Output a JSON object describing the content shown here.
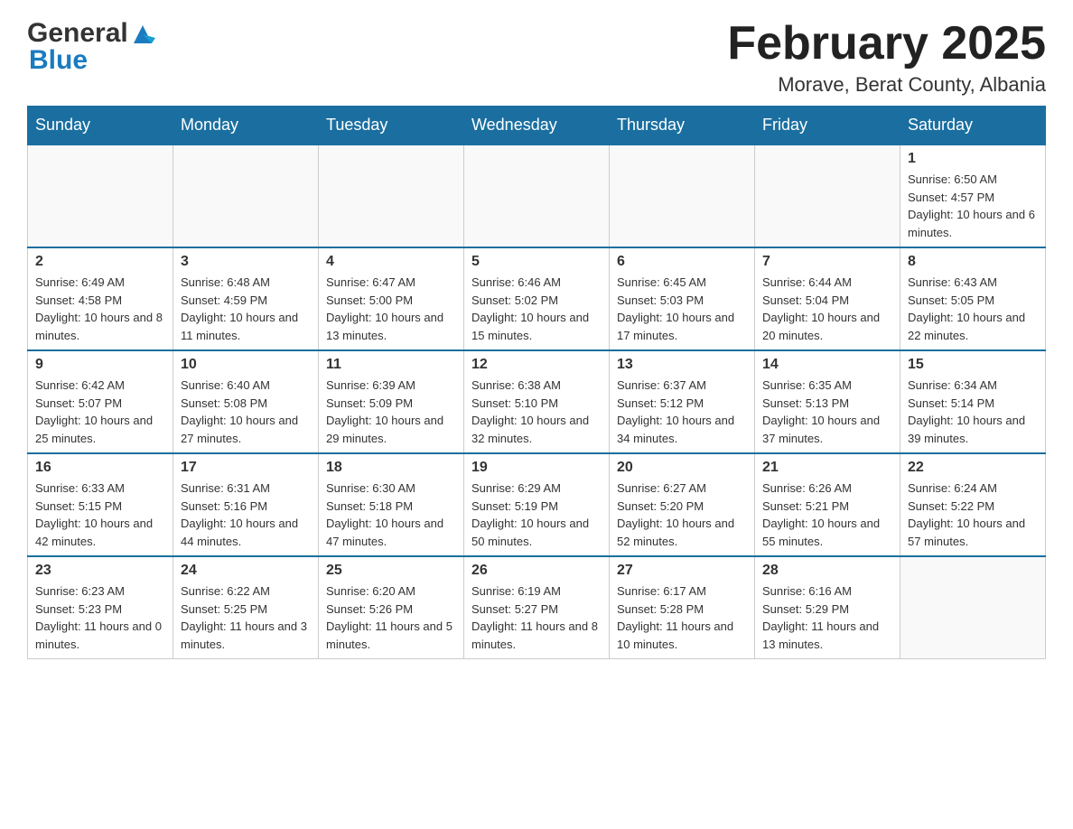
{
  "header": {
    "logo_general": "General",
    "logo_blue": "Blue",
    "title": "February 2025",
    "location": "Morave, Berat County, Albania"
  },
  "days_of_week": [
    "Sunday",
    "Monday",
    "Tuesday",
    "Wednesday",
    "Thursday",
    "Friday",
    "Saturday"
  ],
  "weeks": [
    {
      "cells": [
        {
          "day": null,
          "info": null
        },
        {
          "day": null,
          "info": null
        },
        {
          "day": null,
          "info": null
        },
        {
          "day": null,
          "info": null
        },
        {
          "day": null,
          "info": null
        },
        {
          "day": null,
          "info": null
        },
        {
          "day": "1",
          "info": "Sunrise: 6:50 AM\nSunset: 4:57 PM\nDaylight: 10 hours and 6 minutes."
        }
      ]
    },
    {
      "cells": [
        {
          "day": "2",
          "info": "Sunrise: 6:49 AM\nSunset: 4:58 PM\nDaylight: 10 hours and 8 minutes."
        },
        {
          "day": "3",
          "info": "Sunrise: 6:48 AM\nSunset: 4:59 PM\nDaylight: 10 hours and 11 minutes."
        },
        {
          "day": "4",
          "info": "Sunrise: 6:47 AM\nSunset: 5:00 PM\nDaylight: 10 hours and 13 minutes."
        },
        {
          "day": "5",
          "info": "Sunrise: 6:46 AM\nSunset: 5:02 PM\nDaylight: 10 hours and 15 minutes."
        },
        {
          "day": "6",
          "info": "Sunrise: 6:45 AM\nSunset: 5:03 PM\nDaylight: 10 hours and 17 minutes."
        },
        {
          "day": "7",
          "info": "Sunrise: 6:44 AM\nSunset: 5:04 PM\nDaylight: 10 hours and 20 minutes."
        },
        {
          "day": "8",
          "info": "Sunrise: 6:43 AM\nSunset: 5:05 PM\nDaylight: 10 hours and 22 minutes."
        }
      ]
    },
    {
      "cells": [
        {
          "day": "9",
          "info": "Sunrise: 6:42 AM\nSunset: 5:07 PM\nDaylight: 10 hours and 25 minutes."
        },
        {
          "day": "10",
          "info": "Sunrise: 6:40 AM\nSunset: 5:08 PM\nDaylight: 10 hours and 27 minutes."
        },
        {
          "day": "11",
          "info": "Sunrise: 6:39 AM\nSunset: 5:09 PM\nDaylight: 10 hours and 29 minutes."
        },
        {
          "day": "12",
          "info": "Sunrise: 6:38 AM\nSunset: 5:10 PM\nDaylight: 10 hours and 32 minutes."
        },
        {
          "day": "13",
          "info": "Sunrise: 6:37 AM\nSunset: 5:12 PM\nDaylight: 10 hours and 34 minutes."
        },
        {
          "day": "14",
          "info": "Sunrise: 6:35 AM\nSunset: 5:13 PM\nDaylight: 10 hours and 37 minutes."
        },
        {
          "day": "15",
          "info": "Sunrise: 6:34 AM\nSunset: 5:14 PM\nDaylight: 10 hours and 39 minutes."
        }
      ]
    },
    {
      "cells": [
        {
          "day": "16",
          "info": "Sunrise: 6:33 AM\nSunset: 5:15 PM\nDaylight: 10 hours and 42 minutes."
        },
        {
          "day": "17",
          "info": "Sunrise: 6:31 AM\nSunset: 5:16 PM\nDaylight: 10 hours and 44 minutes."
        },
        {
          "day": "18",
          "info": "Sunrise: 6:30 AM\nSunset: 5:18 PM\nDaylight: 10 hours and 47 minutes."
        },
        {
          "day": "19",
          "info": "Sunrise: 6:29 AM\nSunset: 5:19 PM\nDaylight: 10 hours and 50 minutes."
        },
        {
          "day": "20",
          "info": "Sunrise: 6:27 AM\nSunset: 5:20 PM\nDaylight: 10 hours and 52 minutes."
        },
        {
          "day": "21",
          "info": "Sunrise: 6:26 AM\nSunset: 5:21 PM\nDaylight: 10 hours and 55 minutes."
        },
        {
          "day": "22",
          "info": "Sunrise: 6:24 AM\nSunset: 5:22 PM\nDaylight: 10 hours and 57 minutes."
        }
      ]
    },
    {
      "cells": [
        {
          "day": "23",
          "info": "Sunrise: 6:23 AM\nSunset: 5:23 PM\nDaylight: 11 hours and 0 minutes."
        },
        {
          "day": "24",
          "info": "Sunrise: 6:22 AM\nSunset: 5:25 PM\nDaylight: 11 hours and 3 minutes."
        },
        {
          "day": "25",
          "info": "Sunrise: 6:20 AM\nSunset: 5:26 PM\nDaylight: 11 hours and 5 minutes."
        },
        {
          "day": "26",
          "info": "Sunrise: 6:19 AM\nSunset: 5:27 PM\nDaylight: 11 hours and 8 minutes."
        },
        {
          "day": "27",
          "info": "Sunrise: 6:17 AM\nSunset: 5:28 PM\nDaylight: 11 hours and 10 minutes."
        },
        {
          "day": "28",
          "info": "Sunrise: 6:16 AM\nSunset: 5:29 PM\nDaylight: 11 hours and 13 minutes."
        },
        {
          "day": null,
          "info": null
        }
      ]
    }
  ]
}
